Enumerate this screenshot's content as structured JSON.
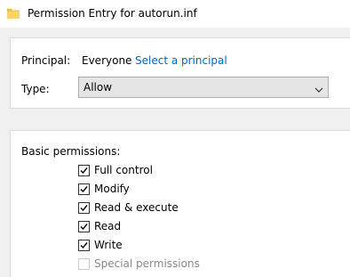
{
  "window": {
    "title": "Permission Entry for autorun.inf",
    "icon": "folder-icon"
  },
  "principal": {
    "label": "Principal:",
    "value": "Everyone",
    "link": "Select a principal"
  },
  "type": {
    "label": "Type:",
    "selected": "Allow"
  },
  "basic_permissions": {
    "label": "Basic permissions:",
    "items": [
      {
        "label": "Full control",
        "checked": true,
        "enabled": true
      },
      {
        "label": "Modify",
        "checked": true,
        "enabled": true
      },
      {
        "label": "Read & execute",
        "checked": true,
        "enabled": true
      },
      {
        "label": "Read",
        "checked": true,
        "enabled": true
      },
      {
        "label": "Write",
        "checked": true,
        "enabled": true
      },
      {
        "label": "Special permissions",
        "checked": false,
        "enabled": false
      }
    ]
  },
  "colors": {
    "link": "#0066cc",
    "disabled_text": "#8a8a8a",
    "background": "#f0f0f0"
  }
}
